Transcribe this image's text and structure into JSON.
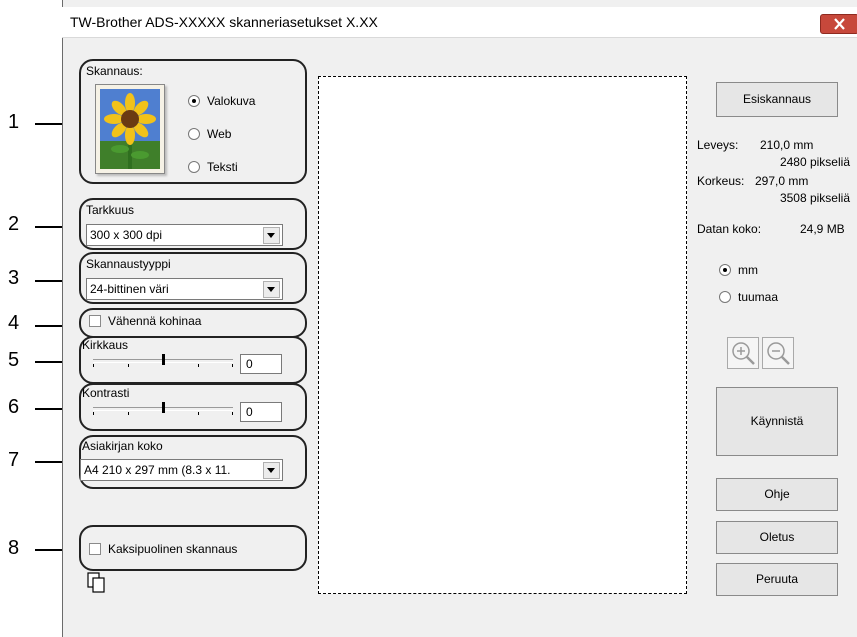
{
  "window": {
    "title": "TW-Brother ADS-XXXXX skanneriasetukset X.XX"
  },
  "callouts": [
    "1",
    "2",
    "3",
    "4",
    "5",
    "6",
    "7",
    "8"
  ],
  "scan": {
    "label": "Skannaus:",
    "options": [
      "Valokuva",
      "Web",
      "Teksti"
    ],
    "selected": "Valokuva"
  },
  "resolution": {
    "label": "Tarkkuus",
    "value": "300 x 300 dpi"
  },
  "scan_type": {
    "label": "Skannaustyyppi",
    "value": "24-bittinen väri"
  },
  "noise": {
    "label": "Vähennä kohinaa",
    "checked": false
  },
  "brightness": {
    "label": "Kirkkaus",
    "value": "0"
  },
  "contrast": {
    "label": "Kontrasti",
    "value": "0"
  },
  "doc_size": {
    "label": "Asiakirjan koko",
    "value": "A4 210 x 297 mm (8.3 x 11."
  },
  "duplex": {
    "label": "Kaksipuolinen skannaus",
    "checked": false
  },
  "buttons": {
    "prescan": "Esiskannaus",
    "start": "Käynnistä",
    "help": "Ohje",
    "default": "Oletus",
    "cancel": "Peruuta"
  },
  "info": {
    "width_label": "Leveys:",
    "width_mm": "210,0 mm",
    "width_px": "2480 pikseliä",
    "height_label": "Korkeus:",
    "height_mm": "297,0 mm",
    "height_px": "3508 pikseliä",
    "data_label": "Datan koko:",
    "data_value": "24,9 MB"
  },
  "units": {
    "options": [
      "mm",
      "tuumaa"
    ],
    "selected": "mm"
  },
  "colors": {
    "close_button": "#c7483b",
    "callout_border": "#222222"
  }
}
